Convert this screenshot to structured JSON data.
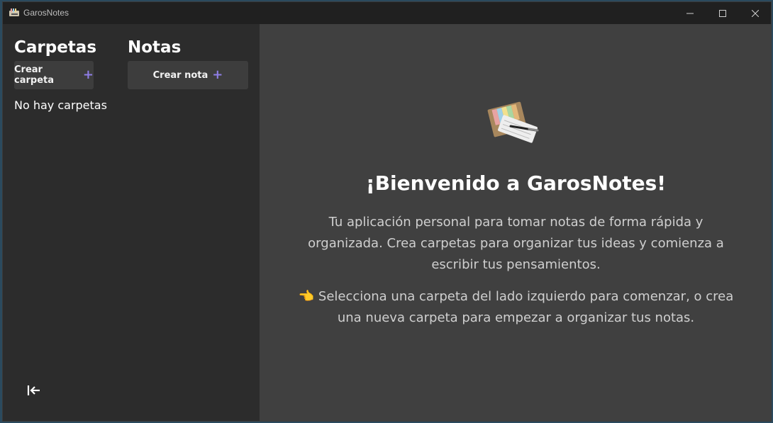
{
  "window": {
    "title": "GarosNotes"
  },
  "sidebar": {
    "folders_title": "Carpetas",
    "notes_title": "Notas",
    "create_folder_label": "Crear carpeta",
    "create_note_label": "Crear nota",
    "empty_folders": "No hay carpetas"
  },
  "main": {
    "welcome_title": "¡Bienvenido a GarosNotes!",
    "description": "Tu aplicación personal para tomar notas de forma rápida y organizada. Crea carpetas para organizar tus ideas y comienza a escribir tus pensamientos.",
    "instruction": "Selecciona una carpeta del lado izquierdo para comenzar, o crea una nueva carpeta para empezar a organizar tus notas.",
    "instruction_icon": "pointing-hand-icon"
  },
  "colors": {
    "accent": "#8f7ee6",
    "sidebar_bg": "#2c2c2c",
    "main_bg": "#404040"
  }
}
